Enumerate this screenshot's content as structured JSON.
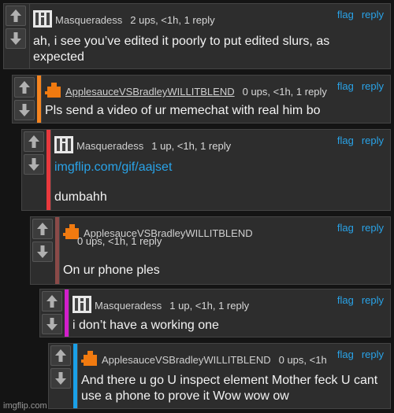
{
  "comments": [
    {
      "user": "Masqueradess",
      "stats": "2 ups, <1h, 1 reply",
      "text": "ah, i see you’ve edited it poorly to put edited slurs, as expected"
    },
    {
      "user": "ApplesauceVSBradleyWILLITBLEND",
      "stats": "0 ups, <1h, 1 reply",
      "text": "Pls send a video of ur memechat with real him bo"
    },
    {
      "user": "Masqueradess",
      "stats": "1 up, <1h, 1 reply",
      "link": "imgflip.com/gif/aajset",
      "text": "dumbahh"
    },
    {
      "user": "ApplesauceVSBradleyWILLITBLEND",
      "stats": "0 ups, <1h, 1 reply",
      "text": "On ur phone ples"
    },
    {
      "user": "Masqueradess",
      "stats": "1 up, <1h, 1 reply",
      "text": "i don’t have a working one"
    },
    {
      "user": "ApplesauceVSBradleyWILLITBLEND",
      "stats": "0 ups, <1h",
      "text": "And there u go U inspect element Mother feck U cant use a phone to prove it Wow wow ow"
    }
  ],
  "actions": {
    "flag": "flag",
    "reply": "reply"
  },
  "footer": "imgflip.com",
  "colors": {
    "bar_level2": "#f5841f",
    "bar_level3": "#e8393d",
    "bar_level4": "#8a4a48",
    "bar_level5": "#d21ecb",
    "bar_level6": "#1aa0e8",
    "link": "#29a3e8",
    "avatar_orange": "#f07a10"
  }
}
